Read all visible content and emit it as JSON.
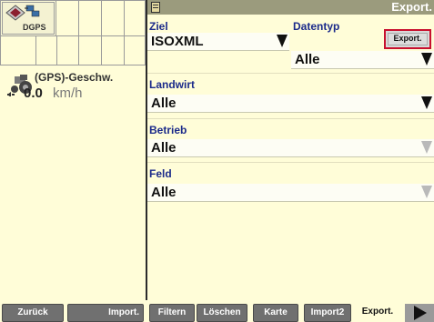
{
  "status": {
    "gps_label": "DGPS"
  },
  "speed": {
    "title": "(GPS)-Geschw.",
    "value": "0.0",
    "unit": "km/h"
  },
  "panel": {
    "title": "Export."
  },
  "fields": {
    "ziel": {
      "label": "Ziel",
      "value": "ISOXML"
    },
    "datentyp": {
      "label": "Datentyp",
      "value": "Alle"
    },
    "landwirt": {
      "label": "Landwirt",
      "value": "Alle"
    },
    "betrieb": {
      "label": "Betrieb",
      "value": "Alle"
    },
    "feld": {
      "label": "Feld",
      "value": "Alle"
    }
  },
  "export_button": {
    "label": "Export."
  },
  "toolbar": {
    "zurueck": "Zurück",
    "import": "Import.",
    "filtern": "Filtern",
    "loeschen": "Löschen",
    "karte": "Karte",
    "import2": "Import2",
    "export": "Export."
  },
  "colors": {
    "background": "#fffdd8",
    "label_blue": "#1b2a8a",
    "highlight_red": "#c8102e",
    "button_gray": "#707070",
    "titlebar": "#9b9b7d"
  },
  "icons": {
    "gps": "gps-satellite-icon",
    "vehicle": "tractor-icon",
    "title": "document-icon",
    "next": "play-arrow-icon"
  }
}
